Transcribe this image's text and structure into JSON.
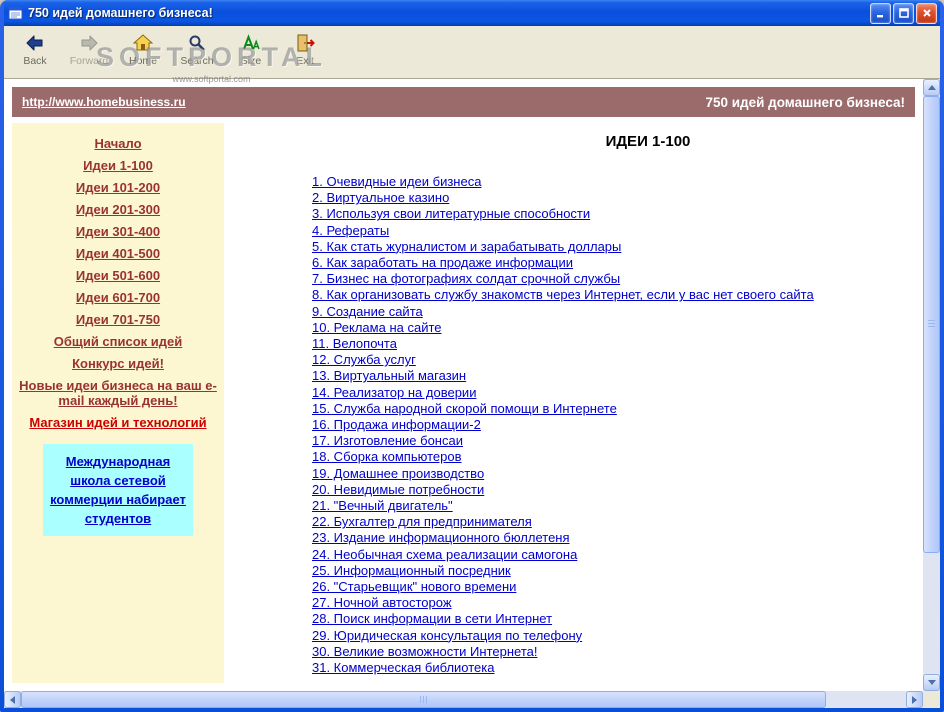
{
  "window": {
    "title": "750 идей домашнего бизнеса!"
  },
  "toolbar": {
    "buttons": [
      {
        "label": "Back",
        "icon": "back-arrow-icon",
        "enabled": true
      },
      {
        "label": "Forward",
        "icon": "forward-arrow-icon",
        "enabled": false
      },
      {
        "label": "Home",
        "icon": "home-icon",
        "enabled": true
      },
      {
        "label": "Search",
        "icon": "search-icon",
        "enabled": true
      },
      {
        "label": "Size",
        "icon": "font-size-icon",
        "enabled": true
      },
      {
        "label": "Exit",
        "icon": "exit-door-icon",
        "enabled": true
      }
    ]
  },
  "watermark": {
    "title": "SOFTPORTAL",
    "url": "www.softportal.com"
  },
  "header": {
    "url": "http://www.homebusiness.ru",
    "title": "750 идей домашнего бизнеса!"
  },
  "sidebar": {
    "items": [
      {
        "label": "Начало"
      },
      {
        "label": "Идеи 1-100"
      },
      {
        "label": "Идеи 101-200"
      },
      {
        "label": "Идеи 201-300"
      },
      {
        "label": "Идеи 301-400"
      },
      {
        "label": "Идеи 401-500"
      },
      {
        "label": "Идеи 501-600"
      },
      {
        "label": "Идеи 601-700"
      },
      {
        "label": "Идеи 701-750"
      },
      {
        "label": "Общий список идей"
      },
      {
        "label": "Конкурс идей!"
      },
      {
        "label": "Новые идеи бизнеса на ваш e-mail каждый день!"
      },
      {
        "label": "Магазин идей и технологий"
      }
    ],
    "promo": {
      "text": "Международная школа сетевой коммерции набирает студентов"
    }
  },
  "main": {
    "title": "ИДЕИ 1-100",
    "links": [
      "1. Очевидные идеи бизнеса",
      "2. Виртуальное казино",
      "3. Используя свои литературные способности",
      "4. Рефераты",
      "5. Как стать журналистом и зарабатывать доллары",
      "6. Как заработать на продаже информации",
      "7. Бизнес на фотографиях солдат срочной службы",
      "8. Как организовать службу знакомств через Интернет, если у вас нет своего сайта",
      "9. Создание сайта",
      "10. Реклама на сайте",
      "11. Велопочта",
      "12. Служба услуг",
      "13. Виртуальный магазин",
      "14. Реализатор на доверии",
      "15. Служба народной скорой помощи в Интернете",
      "16. Продажа информации-2",
      "17. Изготовление бонсаи",
      "18. Сборка компьютеров",
      "19. Домашнее производство",
      "20. Невидимые потребности",
      "21. \"Вечный двигатель\"",
      "22. Бухгалтер для предпринимателя",
      "23. Издание информационного бюллетеня",
      "24. Необычная схема реализации самогона",
      "25. Информационный посредник",
      "26. \"Старьевщик\" нового времени",
      "27. Ночной автосторож",
      "28. Поиск информации в сети Интернет",
      "29. Юридическая консультация по телефону",
      "30. Великие возможности Интернета!",
      "31. Коммерческая библиотека"
    ]
  },
  "theme": {
    "titlebar_blue": "#0a50dd",
    "header_bg": "#9b6b6b",
    "sidebar_bg": "#fcf7d0",
    "promo_bg": "#aaffff",
    "link_color": "#0000cc",
    "sidebar_link_color": "#993333",
    "accent_link_color": "#cc0000"
  }
}
